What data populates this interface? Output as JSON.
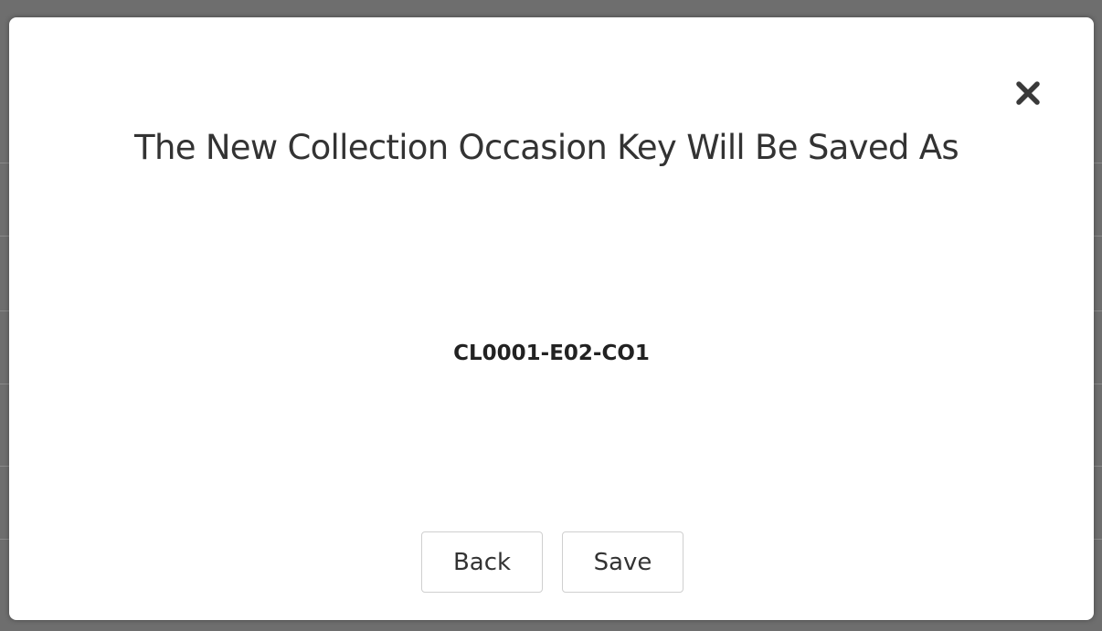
{
  "dialog": {
    "title": "The New Collection Occasion Key Will Be Saved As",
    "key_value": "CL0001-E02-CO1",
    "close_icon": "close-icon",
    "buttons": {
      "back_label": "Back",
      "save_label": "Save"
    }
  },
  "colors": {
    "backdrop": "#6e6e6e",
    "modal_background": "#ffffff",
    "text": "#333333",
    "button_border": "#cfcfcf"
  }
}
